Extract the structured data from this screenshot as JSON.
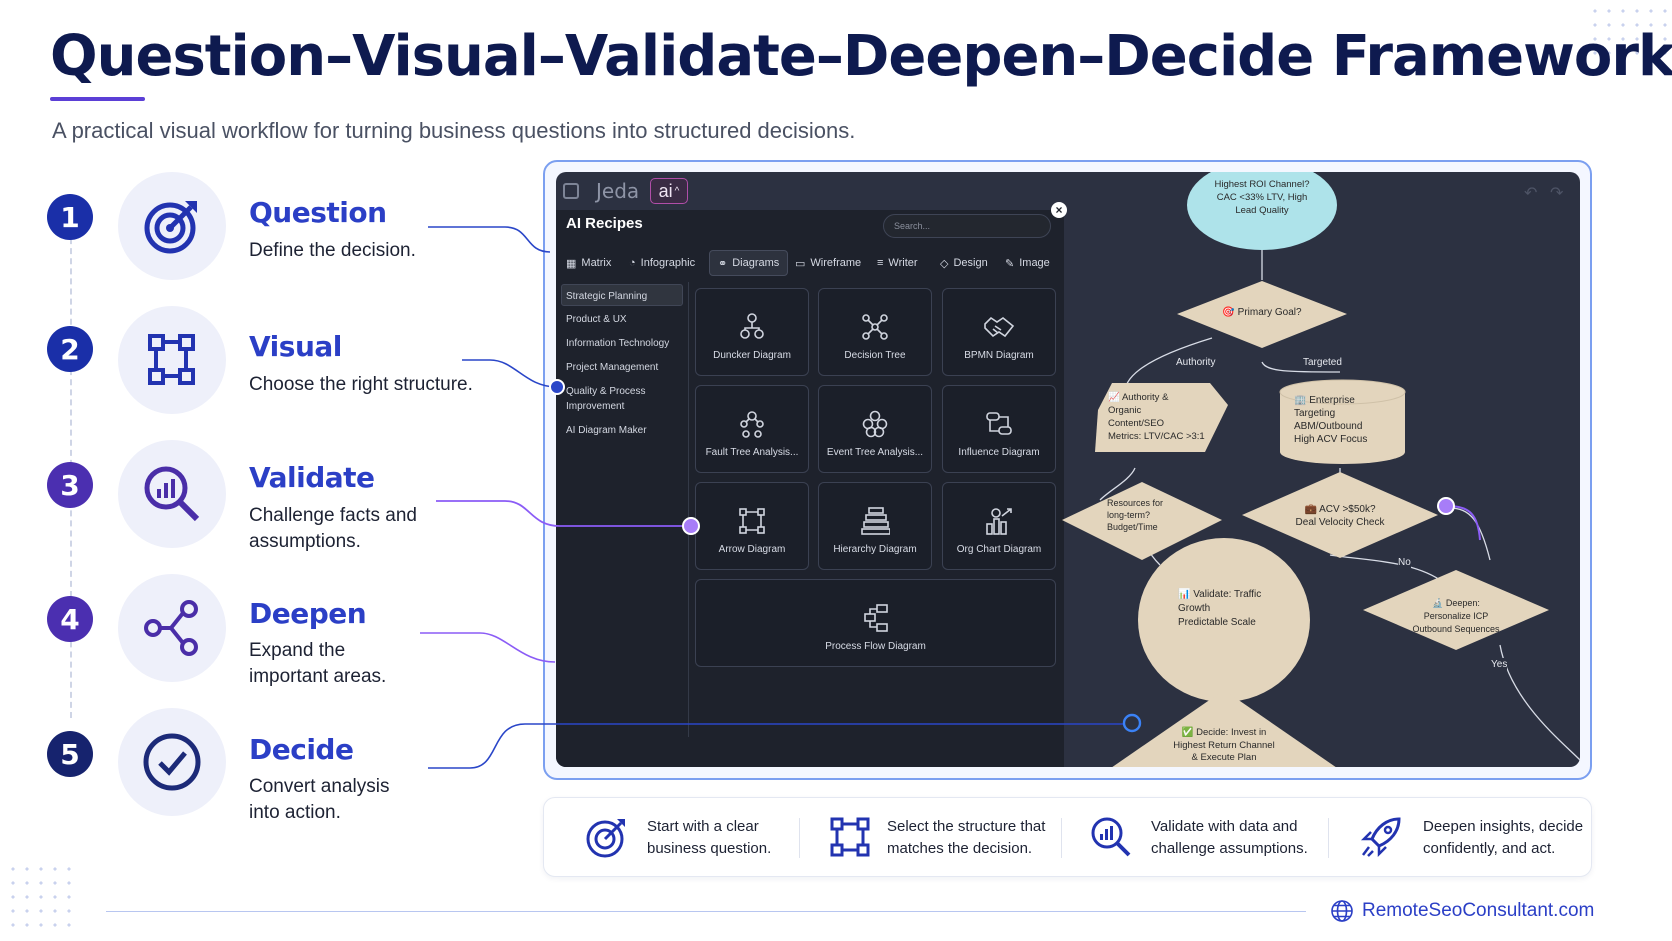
{
  "header": {
    "title": "Question–Visual–Validate–Deepen–Decide Framework",
    "subtitle": "A practical visual workflow for turning business questions into structured decisions."
  },
  "steps": [
    {
      "number": "1",
      "title": "Question",
      "desc": "Define the decision.",
      "icon": "target-arrow-icon",
      "color": "#1a2fa8"
    },
    {
      "number": "2",
      "title": "Visual",
      "desc": "Choose the right structure.",
      "icon": "structure-diagram-icon",
      "color": "#1a2fa8"
    },
    {
      "number": "3",
      "title": "Validate",
      "desc": "Challenge facts and assumptions.",
      "icon": "magnifier-chart-icon",
      "color": "#4b2fb0"
    },
    {
      "number": "4",
      "title": "Deepen",
      "desc": "Expand the important areas.",
      "icon": "share-nodes-icon",
      "color": "#4b2fb0"
    },
    {
      "number": "5",
      "title": "Decide",
      "desc": "Convert analysis into action.",
      "icon": "check-circle-icon",
      "color": "#16236e"
    }
  ],
  "app": {
    "logo": "Jeda",
    "ai_badge": "ai",
    "panel_title": "AI Recipes",
    "search_placeholder": "Search...",
    "tabs": [
      "Matrix",
      "Infographic",
      "Diagrams",
      "Wireframe",
      "Writer",
      "Design",
      "Image"
    ],
    "active_tab": "Diagrams",
    "sidebar": [
      "Strategic Planning",
      "Product & UX",
      "Information Technology",
      "Project Management",
      "Quality & Process Improvement",
      "AI Diagram Maker"
    ],
    "cards": [
      "Duncker Diagram",
      "Decision Tree",
      "BPMN Diagram",
      "Fault Tree Analysis...",
      "Event Tree Analysis...",
      "Influence Diagram",
      "Arrow Diagram",
      "Hierarchy Diagram",
      "Org Chart Diagram",
      "Process Flow Diagram"
    ]
  },
  "flowchart": {
    "top": "Highest ROI Channel?\nCAC <33% LTV, High\nLead Quality",
    "primary_goal": "🎯 Primary Goal?",
    "edge_authority": "Authority",
    "edge_targeted": "Targeted",
    "authority_node": "📈 Authority &\nOrganic\nContent/SEO\nMetrics: LTV/CAC >3:1",
    "enterprise_node": "🏢 Enterprise\nTargeting\nABM/Outbound\nHigh ACV Focus",
    "resources": "Resources for\nlong-term?\nBudget/Time",
    "acv": "💼 ACV >$50k?\nDeal Velocity Check",
    "edge_no": "No",
    "validate": "📊 Validate: Traffic\nGrowth\nPredictable Scale",
    "deepen": "🔬 Deepen:\nPersonalize ICP\nOutbound Sequences",
    "edge_yes": "Yes",
    "decide": "✅ Decide: Invest in\nHighest Return Channel\n& Execute Plan"
  },
  "bottom": [
    {
      "text": "Start with a clear\nbusiness question.",
      "icon": "target-icon"
    },
    {
      "text": "Select the structure that\nmatches the decision.",
      "icon": "structure-icon"
    },
    {
      "text": "Validate with data and\nchallenge assumptions.",
      "icon": "magnifier-icon"
    },
    {
      "text": "Deepen insights, decide\nconfidently, and act.",
      "icon": "rocket-icon"
    }
  ],
  "footer": {
    "link": "RemoteSeoConsultant.com"
  },
  "colors": {
    "accent_blue": "#2b3fc6",
    "accent_purple": "#8b5cf6",
    "dark_navy": "#0e1a4f",
    "flow_node": "#e3d5bd",
    "flow_top": "#aee3ea"
  }
}
